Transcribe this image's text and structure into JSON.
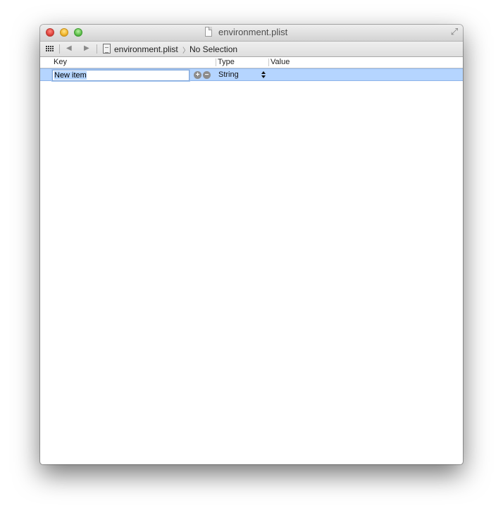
{
  "window": {
    "title": "environment.plist"
  },
  "jumpbar": {
    "file_name": "environment.plist",
    "chevron": "〉",
    "selection": "No Selection"
  },
  "columns": {
    "key": "Key",
    "type": "Type",
    "value": "Value"
  },
  "rows": [
    {
      "key": "New item",
      "type": "String",
      "value": ""
    }
  ],
  "icons": {
    "close": "close-button",
    "minimize": "minimize-button",
    "zoom": "zoom-button",
    "fullscreen": "fullscreen-icon",
    "grid": "grid-icon",
    "back": "back-arrow-icon",
    "forward": "forward-arrow-icon",
    "file": "plist-file-icon",
    "add": "add-row-icon",
    "remove": "remove-row-icon",
    "stepper": "type-stepper-icon"
  },
  "glyphs": {
    "back": "◀",
    "forward": "▶",
    "add": "+",
    "remove": "−",
    "fullscreen": "⤢"
  },
  "colors": {
    "selection_row": "#b5d5ff",
    "close": "#e0443e",
    "minimize": "#f2b52b",
    "zoom": "#5fc04b"
  }
}
